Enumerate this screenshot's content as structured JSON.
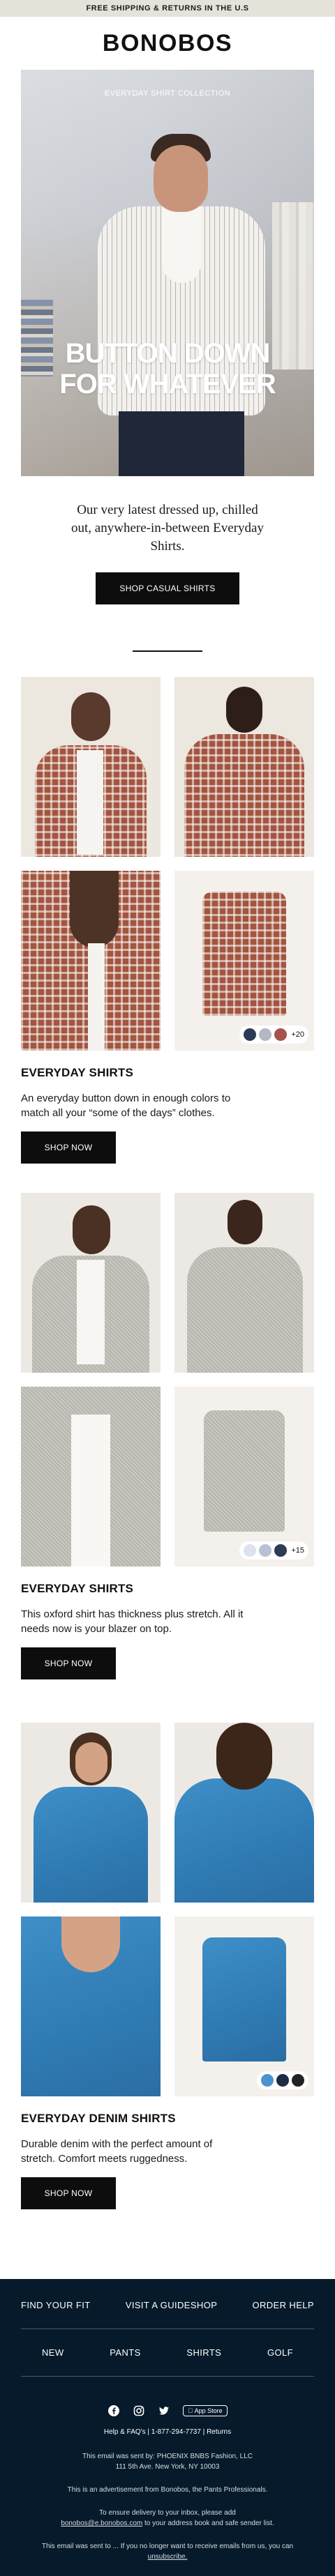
{
  "topbar": {
    "text": "FREE SHIPPING & RETURNS IN THE U.S"
  },
  "brand": {
    "logo": "BONOBOS"
  },
  "hero": {
    "label": "EVERYDAY SHIRT COLLECTION",
    "headline_line1": "BUTTON DOWN",
    "headline_line2": "FOR WHATEVER"
  },
  "intro": {
    "text": "Our very latest dressed up, chilled out, anywhere-in-between Everyday Shirts.",
    "button": "SHOP CASUAL SHIRTS"
  },
  "products": [
    {
      "title": "EVERYDAY SHIRTS",
      "description": "An everyday button down in enough colors to match all your “some of the days” clothes.",
      "button": "SHOP NOW",
      "swatch_colors": [
        "#2b3a55",
        "#b3b8c4",
        "#a5534a"
      ],
      "more_colors": "+20"
    },
    {
      "title": "EVERYDAY SHIRTS",
      "description": "This oxford shirt has thickness plus stretch. All it needs now is your blazer on top.",
      "button": "SHOP NOW",
      "swatch_colors": [
        "#dde3ee",
        "#b9c2d3",
        "#2d3b55"
      ],
      "more_colors": "+15"
    },
    {
      "title": "EVERYDAY DENIM SHIRTS",
      "description": "Durable denim with the perfect amount of stretch. Comfort meets ruggedness.",
      "button": "SHOP NOW",
      "swatch_colors": [
        "#4a93cf",
        "#1f2b45",
        "#222222"
      ],
      "more_colors": ""
    }
  ],
  "footer": {
    "row1": [
      "FIND YOUR FIT",
      "VISIT A GUIDESHOP",
      "ORDER HELP"
    ],
    "row2": [
      "NEW",
      "PANTS",
      "SHIRTS",
      "GOLF"
    ],
    "social_icons": [
      "facebook-icon",
      "instagram-icon",
      "twitter-icon"
    ],
    "app_store": "App Store",
    "help_line": "Help & FAQ's | 1-877-294-7737 | Returns",
    "sent_by": "This email was sent by: PHOENIX BNBS Fashion, LLC",
    "address": "111 5th Ave. New York, NY 10003",
    "advertisement": "This is an advertisement from Bonobos, the Pants Professionals.",
    "delivery_1": "To ensure delivery to your inbox, please add",
    "delivery_email": "bonobos@e.bonobos.com",
    "delivery_2": " to your address book and safe sender list.",
    "unsubscribe_text": "This email was sent to ... If you no longer want to receive emails from us, you can",
    "unsubscribe_link": "unsubscribe."
  },
  "colors": {
    "topbar_bg": "#e5e3d9",
    "button_bg": "#0d0d0d",
    "footer_bg": "#061a2b"
  }
}
